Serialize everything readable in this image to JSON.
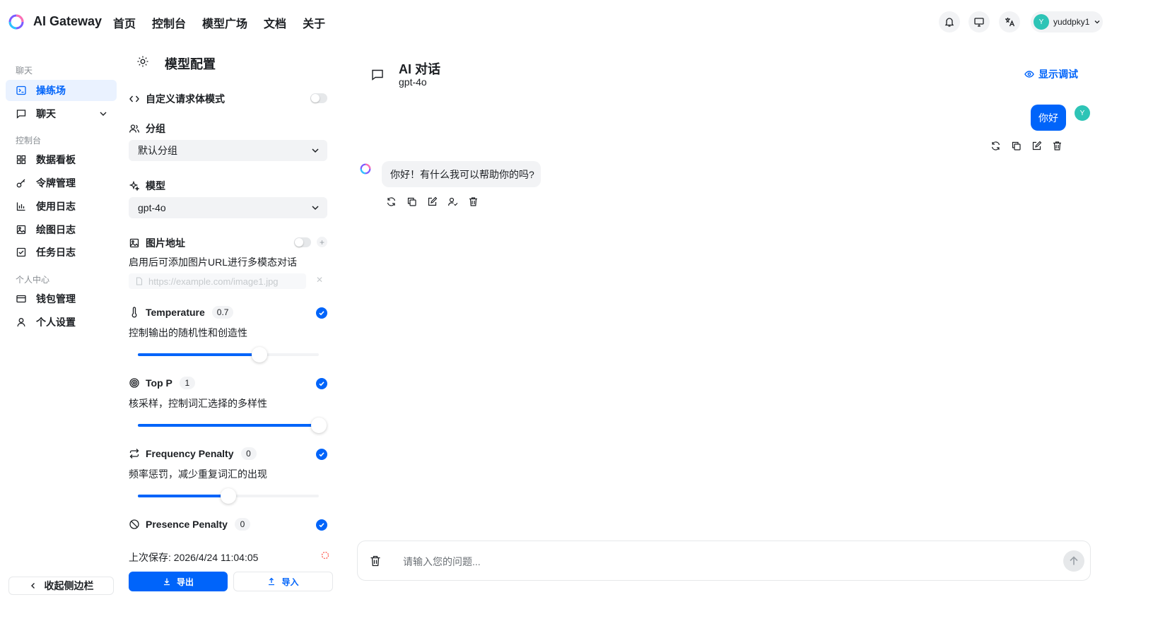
{
  "app": {
    "brand": "AI Gateway",
    "nav": [
      "首页",
      "控制台",
      "模型广场",
      "文档",
      "关于"
    ],
    "user": {
      "initial": "Y",
      "name": "yuddpky1"
    }
  },
  "sidebar": {
    "sections": {
      "chat": "聊天",
      "console": "控制台",
      "personal": "个人中心"
    },
    "items": {
      "playground": "操练场",
      "chat": "聊天",
      "dashboard": "数据看板",
      "tokens": "令牌管理",
      "usage_log": "使用日志",
      "drawing_log": "绘图日志",
      "task_log": "任务日志",
      "wallet": "钱包管理",
      "settings": "个人设置"
    },
    "collapse": "收起侧边栏"
  },
  "config": {
    "title": "模型配置",
    "custom_body": {
      "label": "自定义请求体模式",
      "enabled": false
    },
    "group": {
      "label": "分组",
      "value": "默认分组"
    },
    "model": {
      "label": "模型",
      "value": "gpt-4o"
    },
    "image": {
      "label": "图片地址",
      "enabled": false,
      "desc": "启用后可添加图片URL进行多模态对话",
      "placeholder": "https://example.com/image1.jpg"
    },
    "params": {
      "temperature": {
        "label": "Temperature",
        "value": "0.7",
        "desc": "控制输出的随机性和创造性",
        "level": 0.67,
        "enabled": true
      },
      "top_p": {
        "label": "Top P",
        "value": "1",
        "desc": "核采样，控制词汇选择的多样性",
        "level": 1.0,
        "enabled": true
      },
      "frequency_penalty": {
        "label": "Frequency Penalty",
        "value": "0",
        "desc": "频率惩罚，减少重复词汇的出现",
        "level": 0.5,
        "enabled": true
      },
      "presence_penalty": {
        "label": "Presence Penalty",
        "value": "0",
        "enabled": true
      }
    },
    "last_save": "上次保存: 2026/4/24 11:04:05",
    "export": "导出",
    "import": "导入"
  },
  "chat": {
    "title": "AI 对话",
    "model": "gpt-4o",
    "debug": "显示调试",
    "messages": {
      "user": "你好",
      "bot": "你好！有什么我可以帮助你的吗?"
    },
    "input_placeholder": "请输入您的问题..."
  },
  "colors": {
    "accent": "#0064fa",
    "avatar": "#2ec4b6",
    "muted_bg": "#f2f3f5"
  }
}
